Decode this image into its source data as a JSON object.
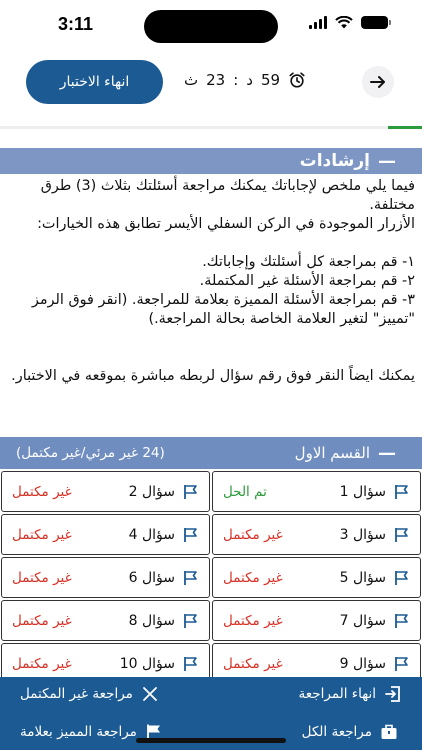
{
  "status": {
    "time": "3:11"
  },
  "topbar": {
    "end_exam_label": "انهاء الاختبار",
    "timer": {
      "minutes": "59",
      "minutes_unit": "د",
      "separator": ":",
      "seconds": "23",
      "seconds_unit": "ث"
    },
    "progress_fraction": 0.08
  },
  "instructions": {
    "title": "إرشادات",
    "collapse_symbol": "—",
    "p1": "فيما يلي ملخص لإجاباتك يمكنك مراجعة أسئلتك بثلاث (3) طرق مختلفة.",
    "p2": "الأزرار الموجودة في الركن السفلي الأيسر تطابق هذه الخيارات:",
    "items": [
      "١-  قم بمراجعة كل أسئلتك وإجاباتك.",
      "٢-  قم بمراجعة الأسئلة غير المكتملة.",
      "٣-  قم بمراجعة الأسئلة المميزة بعلامة للمراجعة. (انقر فوق الرمز \"تمييز\" لتغير العلامة الخاصة بحالة المراجعة.)"
    ],
    "p3": "يمكنك ايضاً النقر فوق رقم سؤال لربطه مباشرة بموقعه في الاختبار."
  },
  "part": {
    "title": "القسم الاول",
    "collapse_symbol": "—",
    "count_label": "(24 غير مرئي/غير مكتمل)"
  },
  "questions": [
    {
      "label": "سؤال 1",
      "status": "تم الحل",
      "state": "done"
    },
    {
      "label": "سؤال 2",
      "status": "غير مكتمل",
      "state": "todo"
    },
    {
      "label": "سؤال 3",
      "status": "غير مكتمل",
      "state": "todo"
    },
    {
      "label": "سؤال 4",
      "status": "غير مكتمل",
      "state": "todo"
    },
    {
      "label": "سؤال 5",
      "status": "غير مكتمل",
      "state": "todo"
    },
    {
      "label": "سؤال 6",
      "status": "غير مكتمل",
      "state": "todo"
    },
    {
      "label": "سؤال 7",
      "status": "غير مكتمل",
      "state": "todo"
    },
    {
      "label": "سؤال 8",
      "status": "غير مكتمل",
      "state": "todo"
    },
    {
      "label": "سؤال 9",
      "status": "غير مكتمل",
      "state": "todo"
    },
    {
      "label": "سؤال 10",
      "status": "غير مكتمل",
      "state": "todo"
    }
  ],
  "bottom_bar": {
    "finish_review": "انهاء المراجعة",
    "review_incomplete": "مراجعة غير المكتمل",
    "review_all": "مراجعة الكل",
    "review_flagged": "مراجعة المميز بعلامة"
  },
  "colors": {
    "primary": "#1b5a93",
    "header": "#7e96c4",
    "solved": "#2c9b3b",
    "incomplete": "#d93025"
  }
}
